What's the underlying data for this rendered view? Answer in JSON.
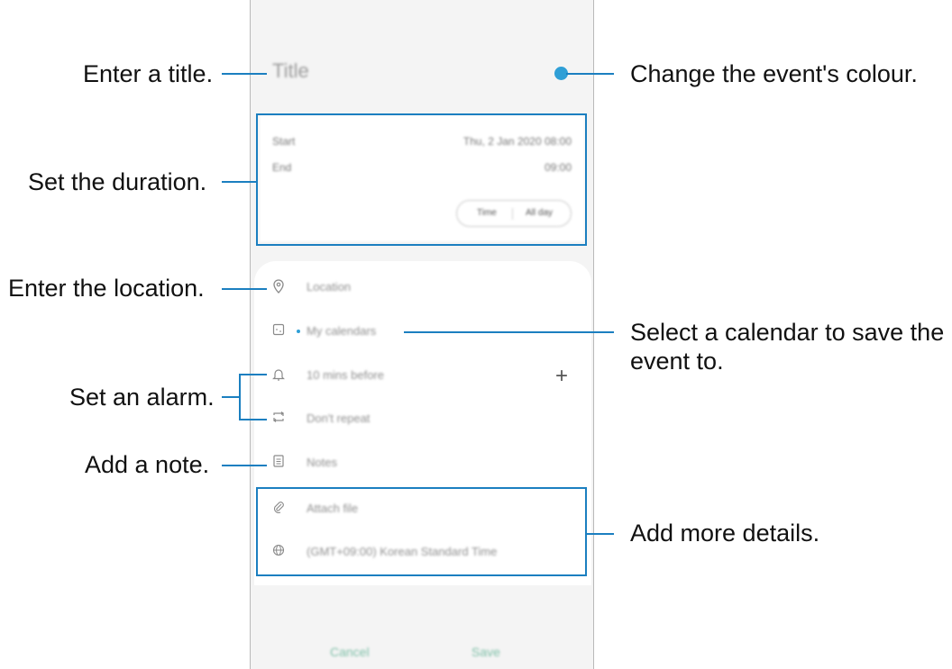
{
  "screen": {
    "title_placeholder": "Title",
    "event_color": "#2f9fd6",
    "start_label": "Start",
    "start_value": "Thu, 2 Jan 2020  08:00",
    "end_label": "End",
    "end_value": "09:00",
    "toggle_time": "Time",
    "toggle_all_day": "All day",
    "rows": [
      {
        "icon": "location-pin-icon",
        "text": "Location"
      },
      {
        "icon": "calendar-icon",
        "text": "My calendars"
      },
      {
        "icon": "bell-icon",
        "text": "10 mins before"
      },
      {
        "icon": "repeat-icon",
        "text": "Don't repeat"
      },
      {
        "icon": "note-icon",
        "text": "Notes"
      },
      {
        "icon": "paperclip-icon",
        "text": "Attach file"
      },
      {
        "icon": "globe-icon",
        "text": "(GMT+09:00) Korean Standard Time"
      }
    ],
    "cancel_label": "Cancel",
    "save_label": "Save"
  },
  "callouts": {
    "title": "Enter a title.",
    "colour": "Change the event's colour.",
    "duration": "Set the duration.",
    "location": "Enter the location.",
    "calendar_line1": "Select a calendar to save the",
    "calendar_line2": "event to.",
    "alarm": "Set an alarm.",
    "note": "Add a note.",
    "details": "Add more details."
  },
  "colors": {
    "accent": "#1b7fc0",
    "event_dot": "#2f9fd6"
  }
}
